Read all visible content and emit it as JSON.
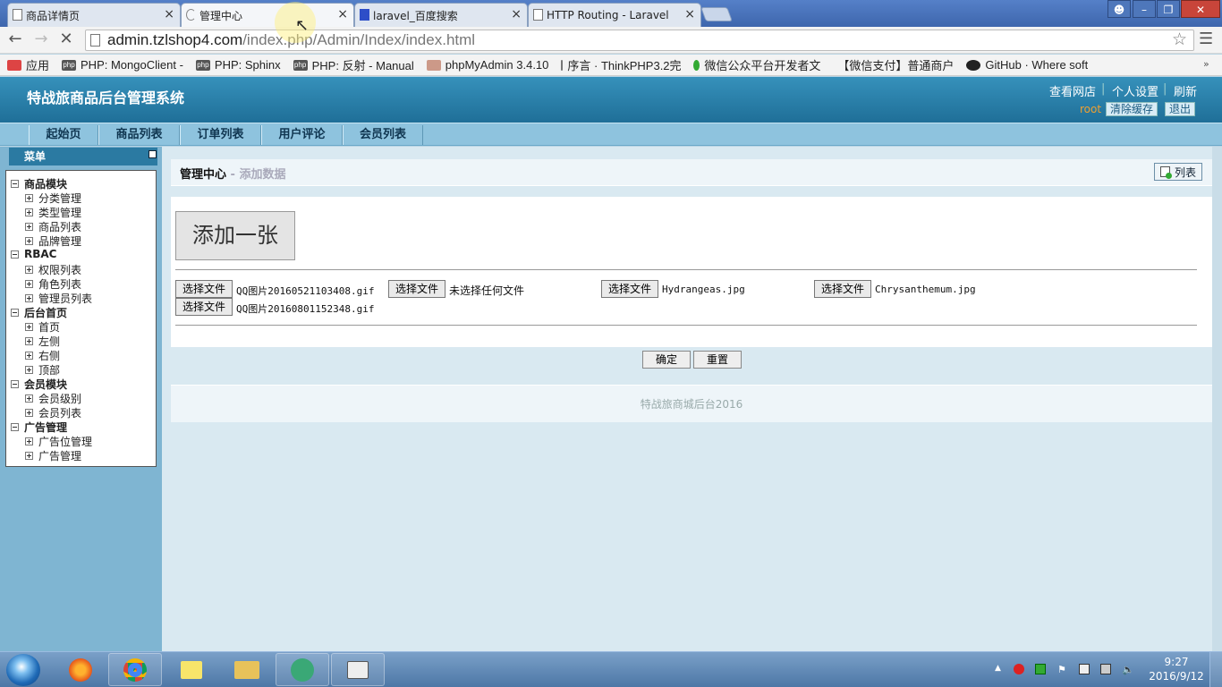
{
  "browser": {
    "tabs": [
      {
        "label": "商品详情页",
        "active": false
      },
      {
        "label": "管理中心",
        "active": true
      },
      {
        "label": "laravel_百度搜索",
        "active": false
      },
      {
        "label": "HTTP Routing - Laravel",
        "active": false
      }
    ],
    "url_host": "admin.tzlshop4.com",
    "url_path": "/index.php/Admin/Index/index.html",
    "bookmarks": [
      {
        "label": "应用",
        "icon": "apps-icon"
      },
      {
        "label": "PHP: MongoClient -",
        "icon": "php-icon"
      },
      {
        "label": "PHP: Sphinx",
        "icon": "php-icon"
      },
      {
        "label": "PHP: 反射 - Manual",
        "icon": "php-icon"
      },
      {
        "label": "phpMyAdmin 3.4.10",
        "icon": "pma-icon"
      },
      {
        "label": "序言 · ThinkPHP3.2完",
        "icon": "page-icon"
      },
      {
        "label": "微信公众平台开发者文",
        "icon": "wechat-icon"
      },
      {
        "label": "【微信支付】普通商户",
        "icon": "wechat-icon"
      },
      {
        "label": "GitHub · Where soft",
        "icon": "github-icon"
      }
    ]
  },
  "header": {
    "title": "特战旅商品后台管理系统",
    "links": [
      "查看网店",
      "个人设置",
      "刷新"
    ],
    "username": "root",
    "clear_cache": "清除缓存",
    "logout": "退出"
  },
  "nav": [
    "起始页",
    "商品列表",
    "订单列表",
    "用户评论",
    "会员列表"
  ],
  "sidebar": {
    "menu_label": "菜单",
    "groups": [
      {
        "label": "商品模块",
        "items": [
          "分类管理",
          "类型管理",
          "商品列表",
          "品牌管理"
        ]
      },
      {
        "label": "RBAC",
        "items": [
          "权限列表",
          "角色列表",
          "管理员列表"
        ]
      },
      {
        "label": "后台首页",
        "items": [
          "首页",
          "左侧",
          "右侧",
          "顶部"
        ]
      },
      {
        "label": "会员模块",
        "items": [
          "会员级别",
          "会员列表"
        ]
      },
      {
        "label": "广告管理",
        "items": [
          "广告位管理",
          "广告管理"
        ]
      }
    ]
  },
  "main": {
    "crumb_title": "管理中心",
    "crumb_sub": " - 添加数据",
    "list_button": "列表",
    "add_one": "添加一张",
    "choose_file": "选择文件",
    "files": [
      "QQ图片20160521103408.gif",
      "未选择任何文件",
      "Hydrangeas.jpg",
      "Chrysanthemum.jpg",
      "QQ图片20160801152348.gif"
    ],
    "confirm": "确定",
    "reset": "重置",
    "footer": "特战旅商城后台2016"
  },
  "taskbar": {
    "time": "9:27",
    "date": "2016/9/12"
  }
}
